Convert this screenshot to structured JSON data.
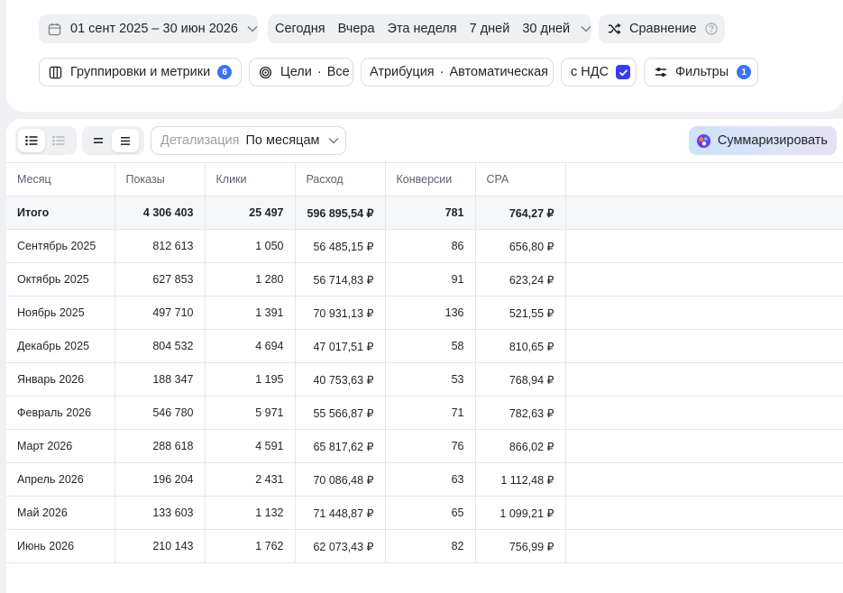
{
  "filters": {
    "date_range": "01 сент 2025 – 30 июн 2026",
    "presets": [
      "Сегодня",
      "Вчера",
      "Эта неделя",
      "7 дней",
      "30 дней"
    ],
    "compare_label": "Сравнение",
    "groupings_label": "Группировки и метрики",
    "groupings_badge": "6",
    "goals_label": "Цели",
    "goals_value": "Все",
    "attribution_label": "Атрибуция",
    "attribution_value": "Автоматическая",
    "vat_label": "с НДС",
    "filters_label": "Фильтры",
    "filters_badge": "1"
  },
  "toolbar": {
    "detail_label": "Детализация",
    "detail_value": "По месяцам",
    "summarize_label": "Суммаризировать"
  },
  "table": {
    "columns": [
      "Месяц",
      "Показы",
      "Клики",
      "Расход",
      "Конверсии",
      "CPA"
    ],
    "total": [
      "Итого",
      "4 306 403",
      "25 497",
      "596 895,54 ₽",
      "781",
      "764,27 ₽"
    ],
    "rows": [
      [
        "Сентябрь 2025",
        "812 613",
        "1 050",
        "56 485,15 ₽",
        "86",
        "656,80 ₽"
      ],
      [
        "Октябрь 2025",
        "627 853",
        "1 280",
        "56 714,83 ₽",
        "91",
        "623,24 ₽"
      ],
      [
        "Ноябрь 2025",
        "497 710",
        "1 391",
        "70 931,13 ₽",
        "136",
        "521,55 ₽"
      ],
      [
        "Декабрь 2025",
        "804 532",
        "4 694",
        "47 017,51 ₽",
        "58",
        "810,65 ₽"
      ],
      [
        "Январь 2026",
        "188 347",
        "1 195",
        "40 753,63 ₽",
        "53",
        "768,94 ₽"
      ],
      [
        "Февраль 2026",
        "546 780",
        "5 971",
        "55 566,87 ₽",
        "71",
        "782,63 ₽"
      ],
      [
        "Март 2026",
        "288 618",
        "4 591",
        "65 817,62 ₽",
        "76",
        "866,02 ₽"
      ],
      [
        "Апрель 2026",
        "196 204",
        "2 431",
        "70 086,48 ₽",
        "63",
        "1 112,48 ₽"
      ],
      [
        "Май 2026",
        "133 603",
        "1 132",
        "71 448,87 ₽",
        "65",
        "1 099,21 ₽"
      ],
      [
        "Июнь 2026",
        "210 143",
        "1 762",
        "62 073,43 ₽",
        "82",
        "756,99 ₽"
      ]
    ]
  },
  "colors": {
    "accent": "#3a74f2",
    "checkbox": "#3a3df0",
    "chip_bg": "#eef0f4"
  },
  "icons": [
    "calendar-icon",
    "chevron-down-icon",
    "shuffle-icon",
    "help-icon",
    "columns-icon",
    "target-icon",
    "sliders-icon",
    "list-icon",
    "summarize-icon"
  ]
}
